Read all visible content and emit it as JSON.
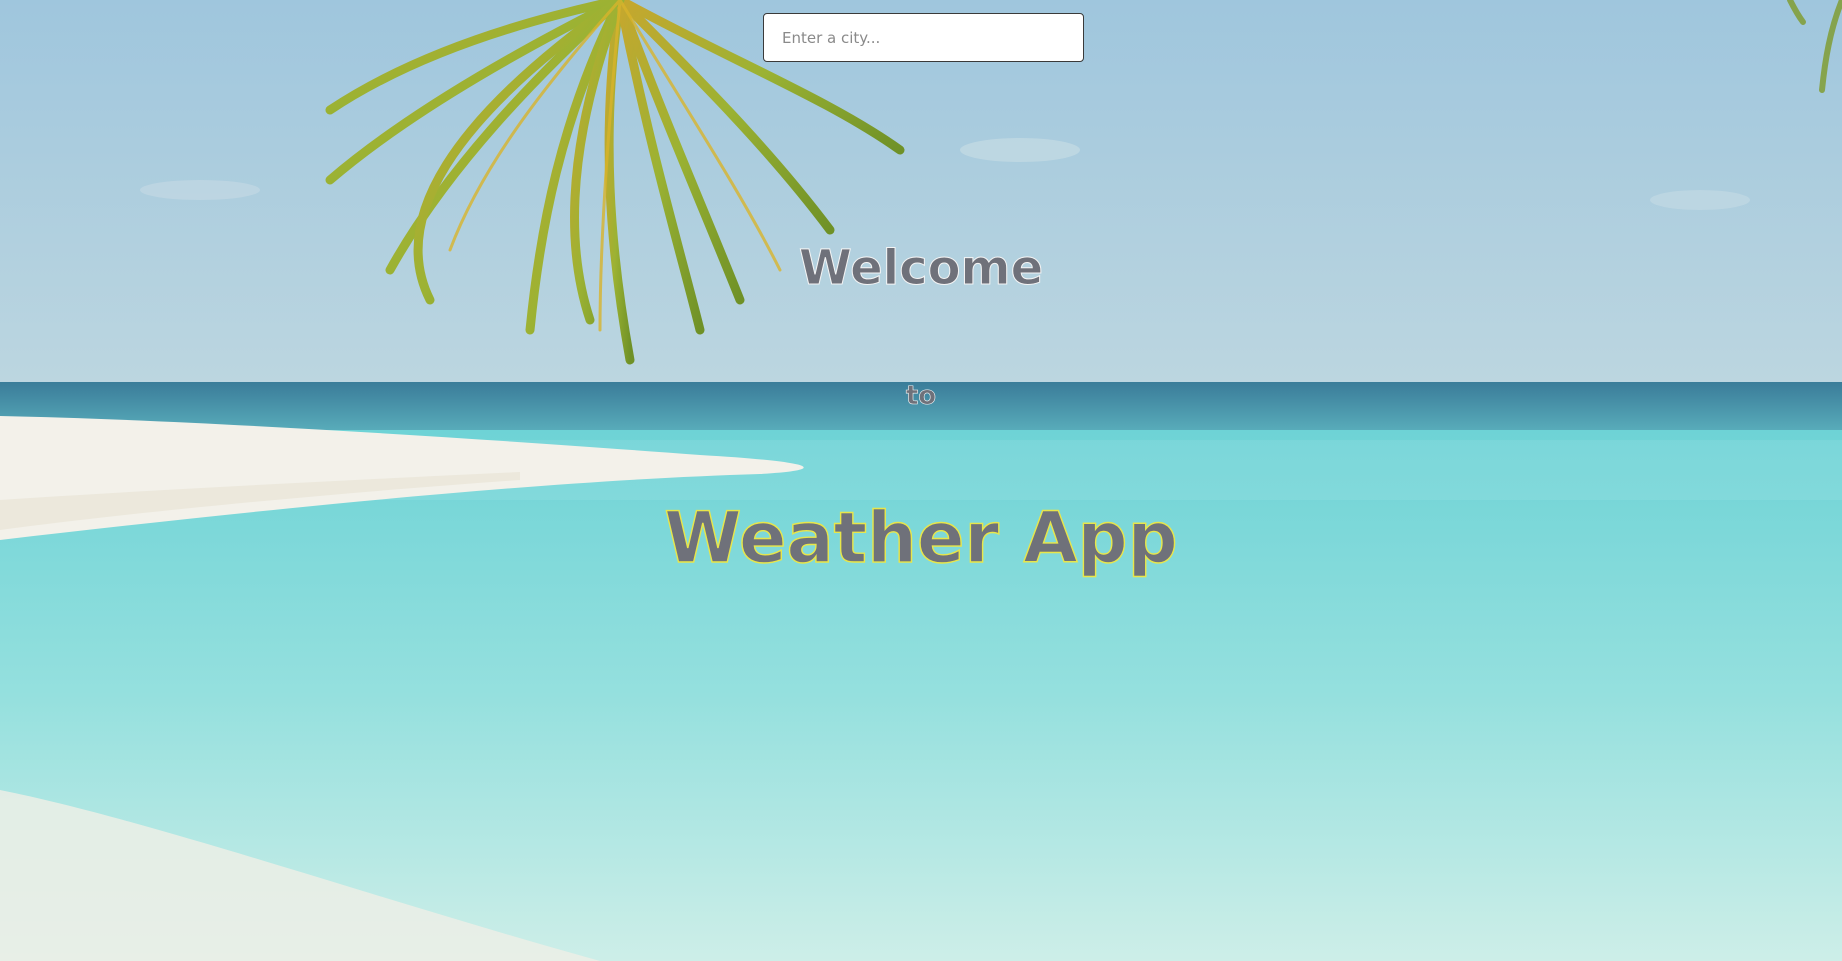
{
  "search": {
    "placeholder": "Enter a city...",
    "value": ""
  },
  "hero": {
    "line1": "Welcome",
    "line2": "to",
    "line3": "Weather App"
  },
  "colors": {
    "heading_text": "#6f717a",
    "heading_outline_title": "#e8e64a",
    "sky": "#a9cfe0",
    "sea": "#7fd6d6",
    "sand": "#f1efe6"
  },
  "background": {
    "icon": "beach-palm-image"
  }
}
